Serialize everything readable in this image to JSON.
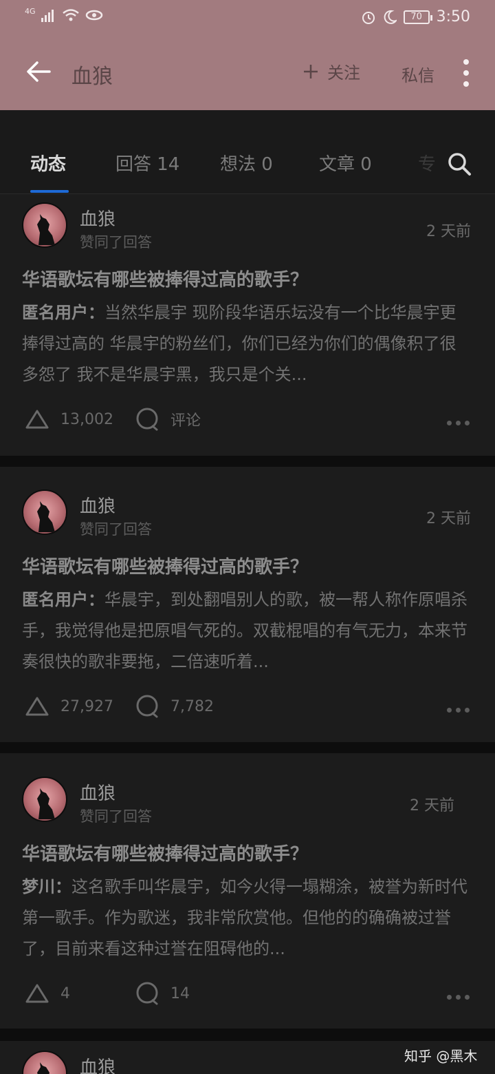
{
  "status_bar": {
    "network": "4G",
    "battery": "70",
    "time": "3:50"
  },
  "header": {
    "title": "血狼",
    "follow_label": "关注",
    "message_label": "私信"
  },
  "tabs": [
    {
      "label": "动态"
    },
    {
      "label": "回答 14"
    },
    {
      "label": "想法 0"
    },
    {
      "label": "文章 0"
    },
    {
      "label": "专"
    }
  ],
  "cards": [
    {
      "author": "血狼",
      "action": "赞同了回答",
      "time": "2 天前",
      "question": "华语歌坛有哪些被捧得过高的歌手？",
      "answerer": "匿名用户：",
      "excerpt": "当然华晨宇 现阶段华语乐坛没有一个比华晨宇更捧得过高的 华晨宇的粉丝们，你们已经为你们的偶像积了很多怨了 我不是华晨宇黑，我只是个关...",
      "upvotes": "13,002",
      "comments": "评论"
    },
    {
      "author": "血狼",
      "action": "赞同了回答",
      "time": "2 天前",
      "question": "华语歌坛有哪些被捧得过高的歌手？",
      "answerer": "匿名用户：",
      "excerpt": "华晨宇，到处翻唱别人的歌，被一帮人称作原唱杀手，我觉得他是把原唱气死的。双截棍唱的有气无力，本来节奏很快的歌非要拖，二倍速听着...",
      "upvotes": "27,927",
      "comments": "7,782"
    },
    {
      "author": "血狼",
      "action": "赞同了回答",
      "time": "2 天前",
      "question": "华语歌坛有哪些被捧得过高的歌手？",
      "answerer": "梦川：",
      "excerpt": "这名歌手叫华晨宇，如今火得一塌糊涂，被誉为新时代第一歌手。作为歌迷，我非常欣赏他。但他的的确确被过誉了，目前来看这种过誉在阻碍他的...",
      "upvotes": "4",
      "comments": "14"
    },
    {
      "author": "血狼"
    }
  ],
  "watermark": "知乎 @黑木"
}
